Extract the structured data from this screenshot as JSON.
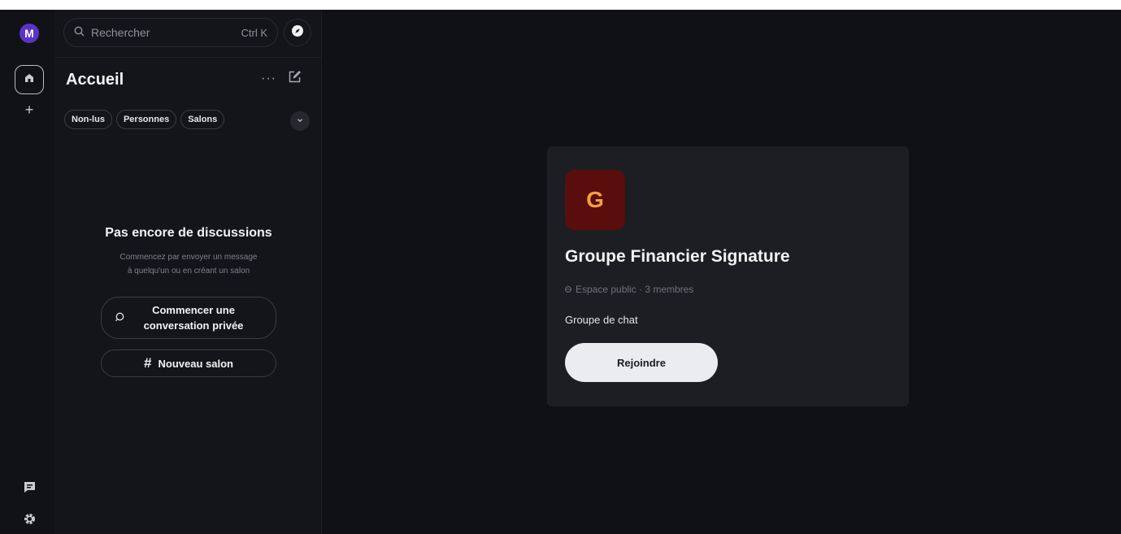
{
  "rail": {
    "avatar_initial": "M",
    "add_label": "+"
  },
  "sidebar": {
    "search": {
      "placeholder": "Rechercher",
      "shortcut": "Ctrl K"
    },
    "title": "Accueil",
    "more_label": "···",
    "filters": [
      "Non-lus",
      "Personnes",
      "Salons"
    ],
    "empty": {
      "title": "Pas encore de discussions",
      "description_line1": "Commencez par envoyer un message",
      "description_line2": "à quelqu'un ou en créant un salon",
      "start_private_line1": "Commencer une",
      "start_private_line2": "conversation privée",
      "new_room_hash": "#",
      "new_room_label": "Nouveau salon"
    }
  },
  "room_preview": {
    "avatar_initial": "G",
    "name": "Groupe Financier Signature",
    "meta": "Espace public · 3 membres",
    "topic": "Groupe de chat",
    "join_label": "Rejoindre"
  },
  "colors": {
    "background": "#101115",
    "card": "#1d1e23",
    "avatar_user": "#5a34c4",
    "room_avatar_bg": "#5a0d0d",
    "room_avatar_fg": "#f2a03d",
    "join_button": "#ebecef"
  },
  "icons": [
    "search-icon",
    "compass-icon",
    "home-icon",
    "plus-icon",
    "compose-icon",
    "chevron-down-icon",
    "chat-icon",
    "gear-icon",
    "globe-icon"
  ]
}
